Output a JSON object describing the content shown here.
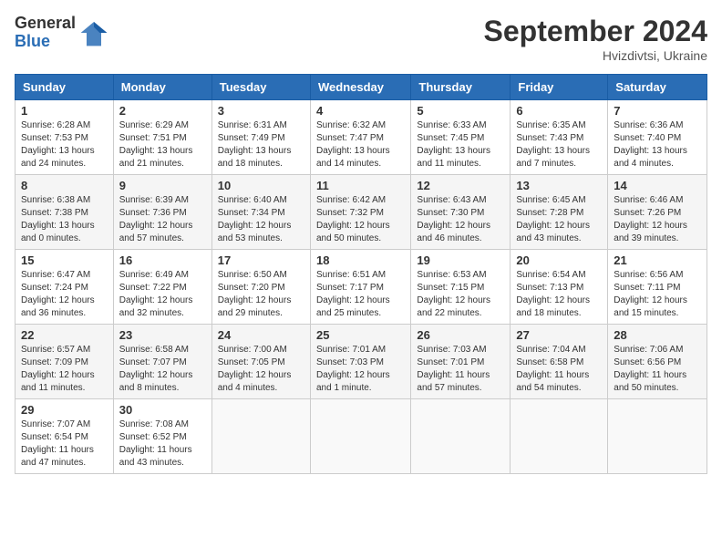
{
  "header": {
    "logo_general": "General",
    "logo_blue": "Blue",
    "month_title": "September 2024",
    "location": "Hvizdivtsi, Ukraine"
  },
  "calendar": {
    "days_of_week": [
      "Sunday",
      "Monday",
      "Tuesday",
      "Wednesday",
      "Thursday",
      "Friday",
      "Saturday"
    ],
    "weeks": [
      [
        {
          "day": "1",
          "info": "Sunrise: 6:28 AM\nSunset: 7:53 PM\nDaylight: 13 hours\nand 24 minutes."
        },
        {
          "day": "2",
          "info": "Sunrise: 6:29 AM\nSunset: 7:51 PM\nDaylight: 13 hours\nand 21 minutes."
        },
        {
          "day": "3",
          "info": "Sunrise: 6:31 AM\nSunset: 7:49 PM\nDaylight: 13 hours\nand 18 minutes."
        },
        {
          "day": "4",
          "info": "Sunrise: 6:32 AM\nSunset: 7:47 PM\nDaylight: 13 hours\nand 14 minutes."
        },
        {
          "day": "5",
          "info": "Sunrise: 6:33 AM\nSunset: 7:45 PM\nDaylight: 13 hours\nand 11 minutes."
        },
        {
          "day": "6",
          "info": "Sunrise: 6:35 AM\nSunset: 7:43 PM\nDaylight: 13 hours\nand 7 minutes."
        },
        {
          "day": "7",
          "info": "Sunrise: 6:36 AM\nSunset: 7:40 PM\nDaylight: 13 hours\nand 4 minutes."
        }
      ],
      [
        {
          "day": "8",
          "info": "Sunrise: 6:38 AM\nSunset: 7:38 PM\nDaylight: 13 hours\nand 0 minutes."
        },
        {
          "day": "9",
          "info": "Sunrise: 6:39 AM\nSunset: 7:36 PM\nDaylight: 12 hours\nand 57 minutes."
        },
        {
          "day": "10",
          "info": "Sunrise: 6:40 AM\nSunset: 7:34 PM\nDaylight: 12 hours\nand 53 minutes."
        },
        {
          "day": "11",
          "info": "Sunrise: 6:42 AM\nSunset: 7:32 PM\nDaylight: 12 hours\nand 50 minutes."
        },
        {
          "day": "12",
          "info": "Sunrise: 6:43 AM\nSunset: 7:30 PM\nDaylight: 12 hours\nand 46 minutes."
        },
        {
          "day": "13",
          "info": "Sunrise: 6:45 AM\nSunset: 7:28 PM\nDaylight: 12 hours\nand 43 minutes."
        },
        {
          "day": "14",
          "info": "Sunrise: 6:46 AM\nSunset: 7:26 PM\nDaylight: 12 hours\nand 39 minutes."
        }
      ],
      [
        {
          "day": "15",
          "info": "Sunrise: 6:47 AM\nSunset: 7:24 PM\nDaylight: 12 hours\nand 36 minutes."
        },
        {
          "day": "16",
          "info": "Sunrise: 6:49 AM\nSunset: 7:22 PM\nDaylight: 12 hours\nand 32 minutes."
        },
        {
          "day": "17",
          "info": "Sunrise: 6:50 AM\nSunset: 7:20 PM\nDaylight: 12 hours\nand 29 minutes."
        },
        {
          "day": "18",
          "info": "Sunrise: 6:51 AM\nSunset: 7:17 PM\nDaylight: 12 hours\nand 25 minutes."
        },
        {
          "day": "19",
          "info": "Sunrise: 6:53 AM\nSunset: 7:15 PM\nDaylight: 12 hours\nand 22 minutes."
        },
        {
          "day": "20",
          "info": "Sunrise: 6:54 AM\nSunset: 7:13 PM\nDaylight: 12 hours\nand 18 minutes."
        },
        {
          "day": "21",
          "info": "Sunrise: 6:56 AM\nSunset: 7:11 PM\nDaylight: 12 hours\nand 15 minutes."
        }
      ],
      [
        {
          "day": "22",
          "info": "Sunrise: 6:57 AM\nSunset: 7:09 PM\nDaylight: 12 hours\nand 11 minutes."
        },
        {
          "day": "23",
          "info": "Sunrise: 6:58 AM\nSunset: 7:07 PM\nDaylight: 12 hours\nand 8 minutes."
        },
        {
          "day": "24",
          "info": "Sunrise: 7:00 AM\nSunset: 7:05 PM\nDaylight: 12 hours\nand 4 minutes."
        },
        {
          "day": "25",
          "info": "Sunrise: 7:01 AM\nSunset: 7:03 PM\nDaylight: 12 hours\nand 1 minute."
        },
        {
          "day": "26",
          "info": "Sunrise: 7:03 AM\nSunset: 7:01 PM\nDaylight: 11 hours\nand 57 minutes."
        },
        {
          "day": "27",
          "info": "Sunrise: 7:04 AM\nSunset: 6:58 PM\nDaylight: 11 hours\nand 54 minutes."
        },
        {
          "day": "28",
          "info": "Sunrise: 7:06 AM\nSunset: 6:56 PM\nDaylight: 11 hours\nand 50 minutes."
        }
      ],
      [
        {
          "day": "29",
          "info": "Sunrise: 7:07 AM\nSunset: 6:54 PM\nDaylight: 11 hours\nand 47 minutes."
        },
        {
          "day": "30",
          "info": "Sunrise: 7:08 AM\nSunset: 6:52 PM\nDaylight: 11 hours\nand 43 minutes."
        },
        {
          "day": "",
          "info": ""
        },
        {
          "day": "",
          "info": ""
        },
        {
          "day": "",
          "info": ""
        },
        {
          "day": "",
          "info": ""
        },
        {
          "day": "",
          "info": ""
        }
      ]
    ]
  }
}
